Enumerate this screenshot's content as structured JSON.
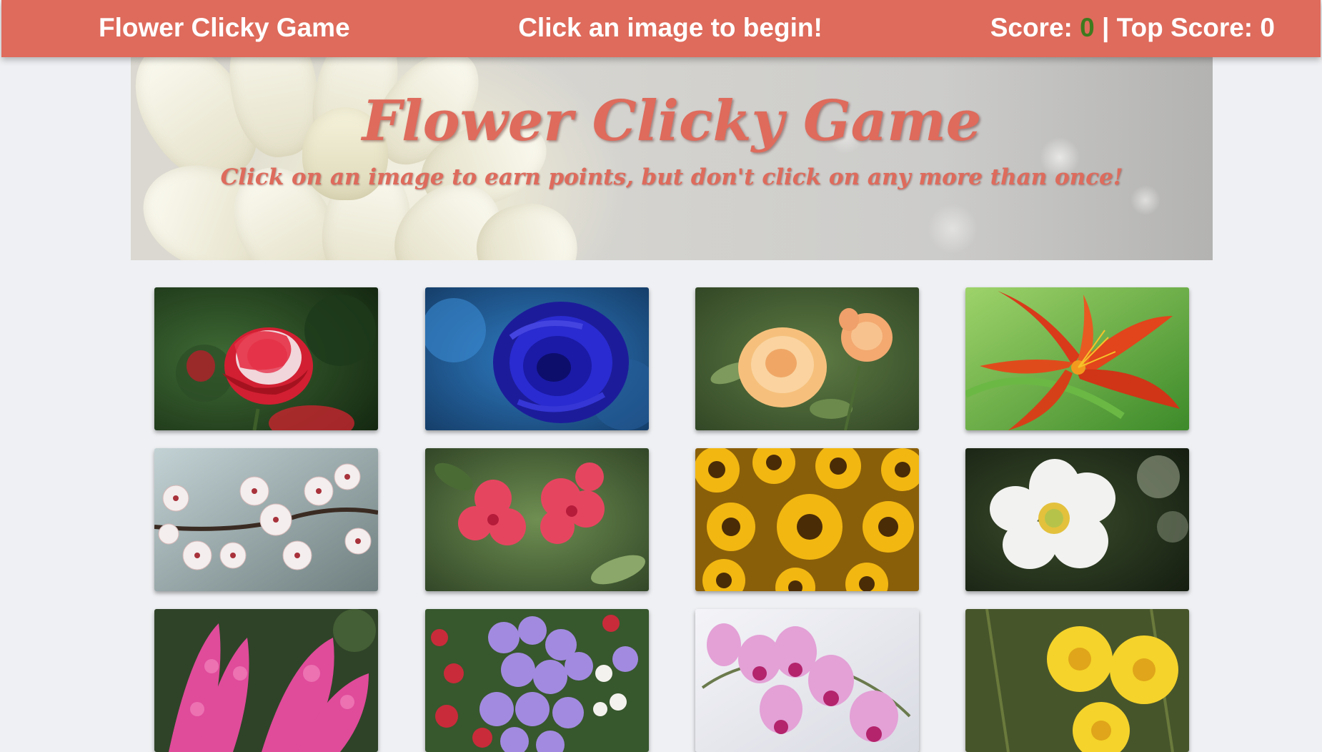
{
  "navbar": {
    "brand": "Flower Clicky Game",
    "message": "Click an image to begin!",
    "score_label": "Score: ",
    "score": "0",
    "separator": " | ",
    "top_score_label": "Top Score: ",
    "top_score": "0"
  },
  "jumbotron": {
    "title": "Flower Clicky Game",
    "subtitle": "Click on an image to earn points, but don't click on any more than once!"
  },
  "colors": {
    "accent": "#de6b5c",
    "score": "#3e7a1e",
    "page_bg": "#eef0f3"
  },
  "cards": [
    {
      "flower": "red-rose"
    },
    {
      "flower": "blue-rose"
    },
    {
      "flower": "peach-rose"
    },
    {
      "flower": "orange-lily"
    },
    {
      "flower": "cherry-blossom"
    },
    {
      "flower": "pink-hibiscus"
    },
    {
      "flower": "sunflowers"
    },
    {
      "flower": "white-anemone"
    },
    {
      "flower": "pink-astilbe"
    },
    {
      "flower": "purple-bellflowers"
    },
    {
      "flower": "pink-orchid"
    },
    {
      "flower": "yellow-daisies"
    }
  ]
}
